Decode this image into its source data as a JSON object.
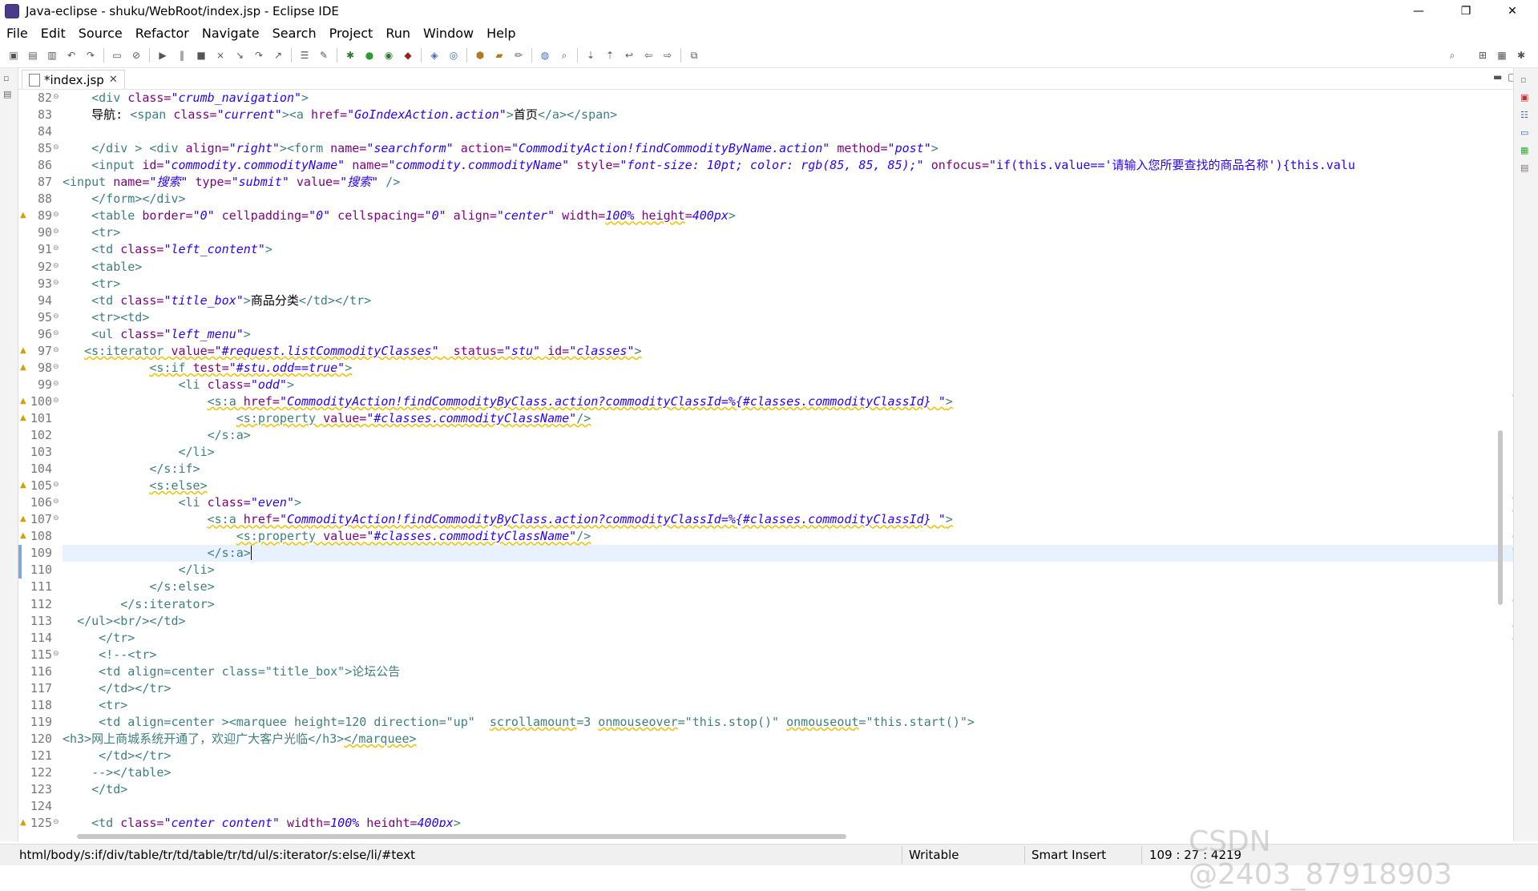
{
  "window": {
    "title": "Java-eclipse - shuku/WebRoot/index.jsp - Eclipse IDE",
    "controls": [
      "—",
      "❐",
      "✕"
    ]
  },
  "menu": [
    "File",
    "Edit",
    "Source",
    "Refactor",
    "Navigate",
    "Search",
    "Project",
    "Run",
    "Window",
    "Help"
  ],
  "tab": {
    "label": "*index.jsp",
    "close": "✕"
  },
  "lines": [
    {
      "n": "82",
      "fold": true,
      "warn": false,
      "html": "<span class='txt'>    </span><span class='tag'>&lt;div </span><span class='attr'>class=</span><span class='val'>\"crumb_navigation\"</span><span class='tag'>&gt;</span>"
    },
    {
      "n": "83",
      "html": "<span class='txt'>    导航: </span><span class='tag'>&lt;span </span><span class='attr'>class=</span><span class='val'>\"current\"</span><span class='tag'>&gt;&lt;a </span><span class='attr'>href=</span><span class='val'>\"GoIndexAction.action\"</span><span class='tag'>&gt;</span><span class='txt'>首页</span><span class='tag'>&lt;/a&gt;&lt;/span&gt;</span>"
    },
    {
      "n": "84",
      "html": ""
    },
    {
      "n": "85",
      "fold": true,
      "html": "<span class='txt'>    </span><span class='tag'>&lt;/div &gt; &lt;div </span><span class='attr'>align=</span><span class='val'>\"right\"</span><span class='tag'>&gt;&lt;form </span><span class='attr'>name=</span><span class='val'>\"searchform\"</span><span class='attr'> action=</span><span class='val'>\"CommodityAction!findCommodityByName.action\"</span><span class='attr'> method=</span><span class='val'>\"post\"</span><span class='tag'>&gt;</span>"
    },
    {
      "n": "86",
      "html": "<span class='txt'>    </span><span class='tag'>&lt;input </span><span class='attr'>id=</span><span class='val'>\"commodity.commodityName\"</span><span class='attr'> name=</span><span class='val'>\"commodity.commodityName\"</span><span class='attr'> style=</span><span class='val'>\"font-size: 10pt; color: rgb(85, 85, 85);\"</span><span class='attr'> onfocus=</span><span style='color:#2a00ff'>\"if(this.value=='请输入您所要查找的商品名称'){this.valu</span>"
    },
    {
      "n": "87",
      "html": "<span class='tag'>&lt;input </span><span class='attr'>name=</span><span class='val'>\"搜索\"</span><span class='attr'> type=</span><span class='val'>\"submit\"</span><span class='attr'> value=</span><span class='val'>\"搜索\"</span><span class='tag'> /&gt;</span>"
    },
    {
      "n": "88",
      "html": "<span class='txt'>    </span><span class='tag'>&lt;/form&gt;&lt;/div&gt;</span>"
    },
    {
      "n": "89",
      "fold": true,
      "warn": true,
      "html": "<span class='txt'>    </span><span class='tag'>&lt;table </span><span class='attr'>border=</span><span class='val'>\"0\"</span><span class='attr'> cellpadding=</span><span class='val'>\"0\"</span><span class='attr'> cellspacing=</span><span class='val'>\"0\"</span><span class='attr'> align=</span><span class='val'>\"center\"</span><span class='attr'> width=</span><span class='val uw'>100%</span><span class='attr uw'> height</span><span class='attr'>=</span><span class='val'>400px</span><span class='tag'>&gt;</span>"
    },
    {
      "n": "90",
      "fold": true,
      "html": "<span class='txt'>    </span><span class='tag'>&lt;tr&gt;</span>"
    },
    {
      "n": "91",
      "fold": true,
      "html": "<span class='txt'>    </span><span class='tag'>&lt;td </span><span class='attr'>class=</span><span class='val'>\"left_content\"</span><span class='tag'>&gt;</span>"
    },
    {
      "n": "92",
      "fold": true,
      "html": "<span class='txt'>    </span><span class='tag'>&lt;table&gt;</span>"
    },
    {
      "n": "93",
      "fold": true,
      "html": "<span class='txt'>    </span><span class='tag'>&lt;tr&gt;</span>"
    },
    {
      "n": "94",
      "html": "<span class='txt'>    </span><span class='tag'>&lt;td </span><span class='attr'>class=</span><span class='val'>\"title_box\"</span><span class='tag'>&gt;</span><span class='txt'>商品分类</span><span class='tag'>&lt;/td&gt;&lt;/tr&gt;</span>"
    },
    {
      "n": "95",
      "fold": true,
      "html": "<span class='txt'>    </span><span class='tag'>&lt;tr&gt;&lt;td&gt;</span>"
    },
    {
      "n": "96",
      "fold": true,
      "html": "<span class='txt'>    </span><span class='tag'>&lt;ul </span><span class='attr'>class=</span><span class='val'>\"left_menu\"</span><span class='tag'>&gt;</span>"
    },
    {
      "n": "97",
      "fold": true,
      "warn": true,
      "html": "<span class='txt'>   </span><span class='tag uw'>&lt;s:iterator </span><span class='attr uw'>value=</span><span class='val uw'>\"#request.listCommodityClasses\"</span><span class='attr uw'>  status=</span><span class='val uw'>\"stu\"</span><span class='attr uw'> id=</span><span class='val uw'>\"classes\"</span><span class='tag uw'>&gt;</span>"
    },
    {
      "n": "98",
      "fold": true,
      "warn": true,
      "html": "<span class='txt'>            </span><span class='tag uw'>&lt;s:if </span><span class='attr uw'>test=</span><span class='val uw'>\"#stu.odd==true\"</span><span class='tag uw'>&gt;</span>"
    },
    {
      "n": "99",
      "fold": true,
      "html": "<span class='txt'>                </span><span class='tag'>&lt;li </span><span class='attr'>class=</span><span class='val'>\"odd\"</span><span class='tag'>&gt;</span>"
    },
    {
      "n": "100",
      "fold": true,
      "warn": true,
      "html": "<span class='txt'>                    </span><span class='tag uw'>&lt;s:a </span><span class='attr uw'>href=</span><span class='val uw'>\"CommodityAction!findCommodityByClass.action?commodityClassId=%{#classes.commodityClassId} \"</span><span class='tag uw'>&gt;</span>"
    },
    {
      "n": "101",
      "warn": true,
      "html": "<span class='txt'>                        </span><span class='tag uw'>&lt;s:property </span><span class='attr uw'>value=</span><span class='val uw'>\"#classes.commodityClassName\"</span><span class='tag uw'>/&gt;</span>"
    },
    {
      "n": "102",
      "html": "<span class='txt'>                    </span><span class='tag'>&lt;/s:a&gt;</span>"
    },
    {
      "n": "103",
      "html": "<span class='txt'>                </span><span class='tag'>&lt;/li&gt;</span>"
    },
    {
      "n": "104",
      "html": "<span class='txt'>            </span><span class='tag'>&lt;/s:if&gt;</span>"
    },
    {
      "n": "105",
      "fold": true,
      "warn": true,
      "html": "<span class='txt'>            </span><span class='tag uw'>&lt;s:else&gt;</span>"
    },
    {
      "n": "106",
      "fold": true,
      "html": "<span class='txt'>                </span><span class='tag'>&lt;li </span><span class='attr'>class=</span><span class='val'>\"even\"</span><span class='tag'>&gt;</span>"
    },
    {
      "n": "107",
      "fold": true,
      "warn": true,
      "html": "<span class='txt'>                    </span><span class='tag uw'>&lt;s:a </span><span class='attr uw'>href=</span><span class='val uw'>\"CommodityAction!findCommodityByClass.action?commodityClassId=%{#classes.commodityClassId} \"</span><span class='tag uw'>&gt;</span>"
    },
    {
      "n": "108",
      "warn": true,
      "html": "<span class='txt'>                        </span><span class='tag uw'>&lt;s:property </span><span class='attr uw'>value=</span><span class='val uw'>\"#classes.commodityClassName\"</span><span class='tag uw'>/&gt;</span>"
    },
    {
      "n": "109",
      "current": true,
      "html": "<span class='txt'>                    </span><span class='tag'>&lt;/s:a&gt;</span><span style='border-left:1px solid #000'></span>"
    },
    {
      "n": "110",
      "html": "<span class='txt'>                </span><span class='tag'>&lt;/li&gt;</span>"
    },
    {
      "n": "111",
      "html": "<span class='txt'>            </span><span class='tag'>&lt;/s:else&gt;</span>"
    },
    {
      "n": "112",
      "html": "<span class='txt'>        </span><span class='tag'>&lt;/s:iterator&gt;</span>"
    },
    {
      "n": "113",
      "html": "<span class='txt'>  </span><span class='tag'>&lt;/ul&gt;&lt;br/&gt;&lt;/td&gt;</span>"
    },
    {
      "n": "114",
      "html": "<span class='txt'>     </span><span class='tag'>&lt;/tr&gt;</span>"
    },
    {
      "n": "115",
      "fold": true,
      "html": "<span class='txt'>     </span><span class='tag'>&lt;!--&lt;tr&gt;</span>"
    },
    {
      "n": "116",
      "html": "<span class='txt'>     </span><span class='tag'>&lt;td align=center class=\"title_box\"&gt;论坛公告</span>"
    },
    {
      "n": "117",
      "html": "<span class='txt'>     </span><span class='tag'>&lt;/td&gt;&lt;/tr&gt;</span>"
    },
    {
      "n": "118",
      "html": "<span class='txt'>     </span><span class='tag'>&lt;tr&gt;</span>"
    },
    {
      "n": "119",
      "html": "<span class='txt'>     </span><span class='tag'>&lt;td align=center &gt;&lt;marquee height=120 direction=\"up\"  <span class='uw'>scrollamount</span>=3 <span class='uw'>onmouseover</span>=\"this.stop()\" <span class='uw'>onmouseout</span>=\"this.start()\"&gt;</span>"
    },
    {
      "n": "120",
      "html": "<span class='tag'>&lt;h3&gt;网上商城系统开通了，欢迎广大客户光临&lt;/h3&gt;<span class='uw'>&lt;/marquee&gt;</span></span>"
    },
    {
      "n": "121",
      "html": "<span class='txt'>     </span><span class='tag'>&lt;/td&gt;&lt;/tr&gt;</span>"
    },
    {
      "n": "122",
      "html": "<span class='txt'>    </span><span class='tag'>--&gt;&lt;/table&gt;</span>"
    },
    {
      "n": "123",
      "html": "<span class='txt'>    </span><span class='tag'>&lt;/td&gt;</span>"
    },
    {
      "n": "124",
      "html": ""
    },
    {
      "n": "125",
      "fold": true,
      "warn": true,
      "html": "<span class='txt'>    </span><span class='tag'>&lt;td </span><span class='attr'>class=</span><span class='val'>\"center_content\"</span><span class='attr'> width=</span><span class='val uw'>100%</span><span class='attr uw'> height</span><span class='attr'>=</span><span class='val'>400px</span><span class='tag'>&gt;</span>"
    }
  ],
  "status": {
    "path": "html/body/s:if/div/table/tr/td/table/tr/td/ul/s:iterator/s:else/li/#text",
    "mode": "Writable",
    "insert": "Smart Insert",
    "position": "109 : 27 : 4219"
  },
  "watermark": "CSDN @2403_87918903"
}
